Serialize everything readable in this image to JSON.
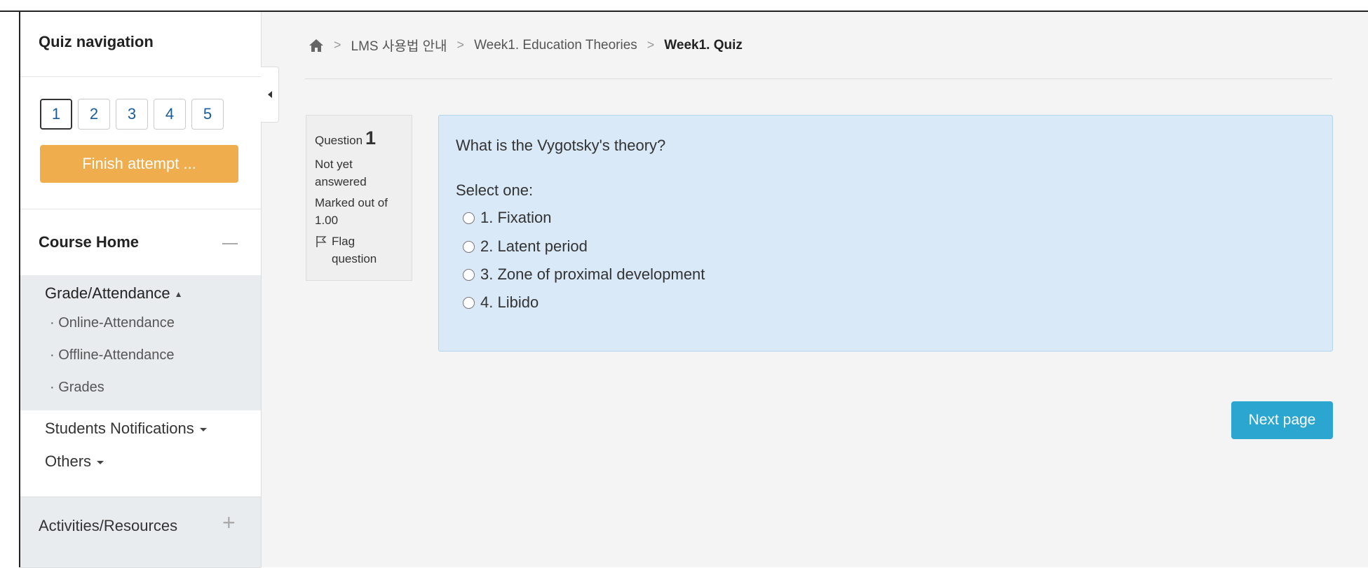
{
  "sidebar": {
    "quiz_nav_title": "Quiz navigation",
    "question_buttons": [
      "1",
      "2",
      "3",
      "4",
      "5"
    ],
    "current_question": "1",
    "finish_label": "Finish attempt ...",
    "course_home_label": "Course Home",
    "grade_attendance_label": "Grade/Attendance",
    "grade_items": [
      "Online-Attendance",
      "Offline-Attendance",
      "Grades"
    ],
    "students_notifications_label": "Students Notifications",
    "others_label": "Others",
    "activities_label": "Activities/Resources"
  },
  "breadcrumb": {
    "items": [
      "LMS 사용법 안내",
      "Week1. Education Theories",
      "Week1. Quiz"
    ]
  },
  "question": {
    "label": "Question",
    "number": "1",
    "status": "Not yet answered",
    "marked_out_of": "Marked out of 1.00",
    "flag_label": "Flag question",
    "text": "What is the Vygotsky's theory?",
    "select_one": "Select one:",
    "answers": [
      "1. Fixation",
      "2. Latent period",
      "3. Zone of proximal development",
      "4. Libido"
    ]
  },
  "next_button_label": "Next page",
  "colors": {
    "finish_button": "#f0ad4e",
    "next_button": "#2aa6d1",
    "question_bg": "#d9e9f7",
    "link": "#1a5c9a"
  }
}
